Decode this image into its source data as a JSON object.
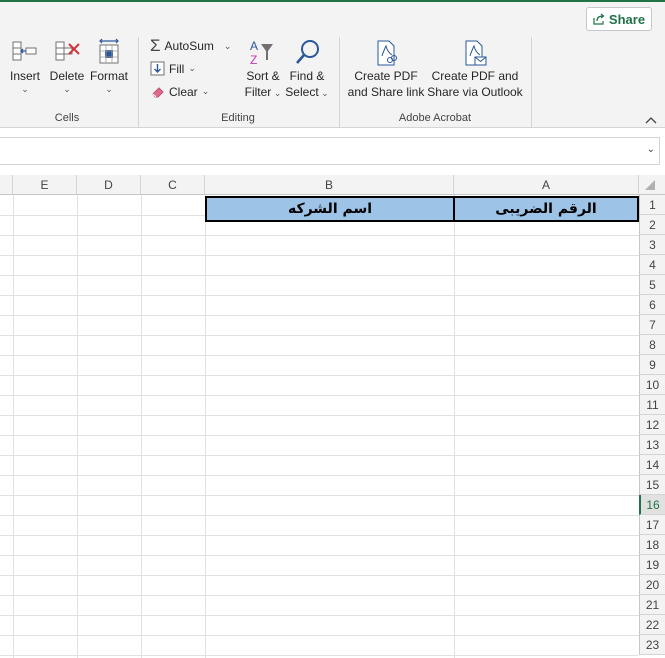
{
  "share": {
    "label": "Share"
  },
  "cells_group": {
    "label": "Cells",
    "insert": "Insert",
    "delete": "Delete",
    "format": "Format"
  },
  "editing_group": {
    "label": "Editing",
    "autosum": "AutoSum",
    "fill": "Fill",
    "clear": "Clear",
    "sort_line1": "Sort &",
    "sort_line2": "Filter",
    "find_line1": "Find &",
    "find_line2": "Select"
  },
  "acrobat_group": {
    "label": "Adobe Acrobat",
    "create_pdf_line1": "Create PDF",
    "create_pdf_line2": "and Share link",
    "create_outlook_line1": "Create PDF and",
    "create_outlook_line2": "Share via Outlook"
  },
  "columns": [
    "E",
    "D",
    "C",
    "B",
    "A"
  ],
  "rows": [
    "1",
    "2",
    "3",
    "4",
    "5",
    "6",
    "7",
    "8",
    "9",
    "10",
    "11",
    "12",
    "13",
    "14",
    "15",
    "16",
    "17",
    "18",
    "19",
    "20",
    "21",
    "22",
    "23"
  ],
  "selected_row": "16",
  "cells": {
    "A1": "الرقم الضريبى",
    "B1": "اسم الشركه"
  },
  "colors": {
    "accent": "#217346",
    "header_fill": "#9dc3e6"
  }
}
